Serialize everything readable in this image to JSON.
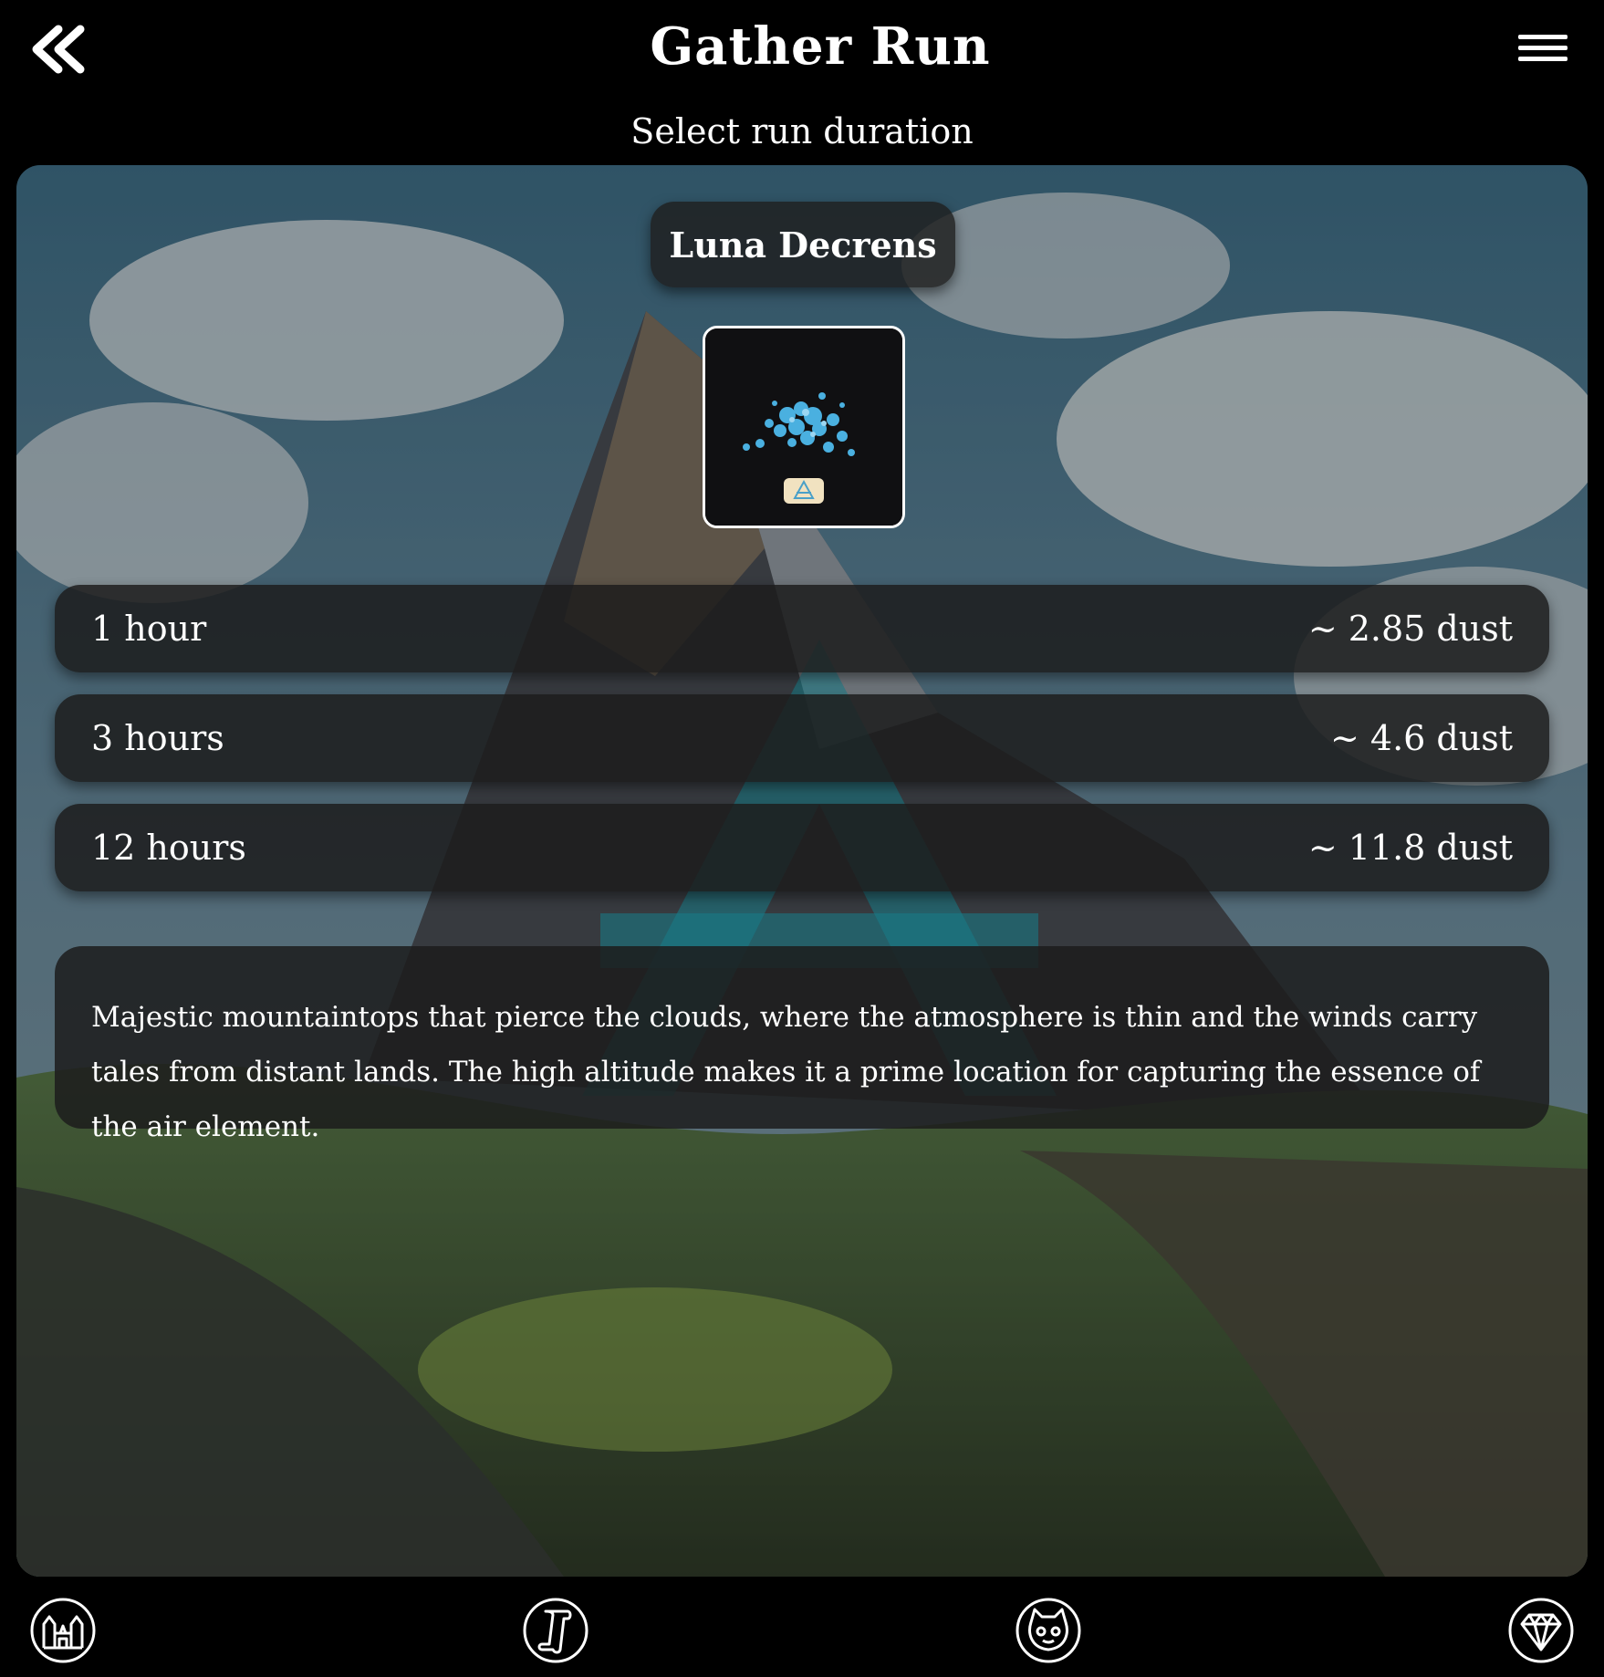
{
  "header": {
    "title": "Gather Run",
    "subtitle": "Select run duration",
    "back_icon": "double-chevron-left-icon",
    "menu_icon": "hamburger-menu-icon"
  },
  "card": {
    "name": "Luna Decrens",
    "image_icon": "blue-dust-crystals-icon"
  },
  "durations": [
    {
      "label": "1 hour",
      "reward": "~ 2.85 dust"
    },
    {
      "label": "3 hours",
      "reward": "~ 4.6 dust"
    },
    {
      "label": "12 hours",
      "reward": "~ 11.8 dust"
    }
  ],
  "description": "Majestic mountaintops that pierce the clouds, where the atmosphere is thin and the winds carry tales from distant lands. The high altitude makes it a prime location for capturing the essence of the air element.",
  "bottom_nav": [
    {
      "icon": "castle-icon"
    },
    {
      "icon": "scroll-icon"
    },
    {
      "icon": "creature-face-icon"
    },
    {
      "icon": "diamond-icon"
    }
  ],
  "colors": {
    "background": "#000000",
    "panel_overlay": "#1c1c1c",
    "air_symbol": "#1fa7b8"
  }
}
